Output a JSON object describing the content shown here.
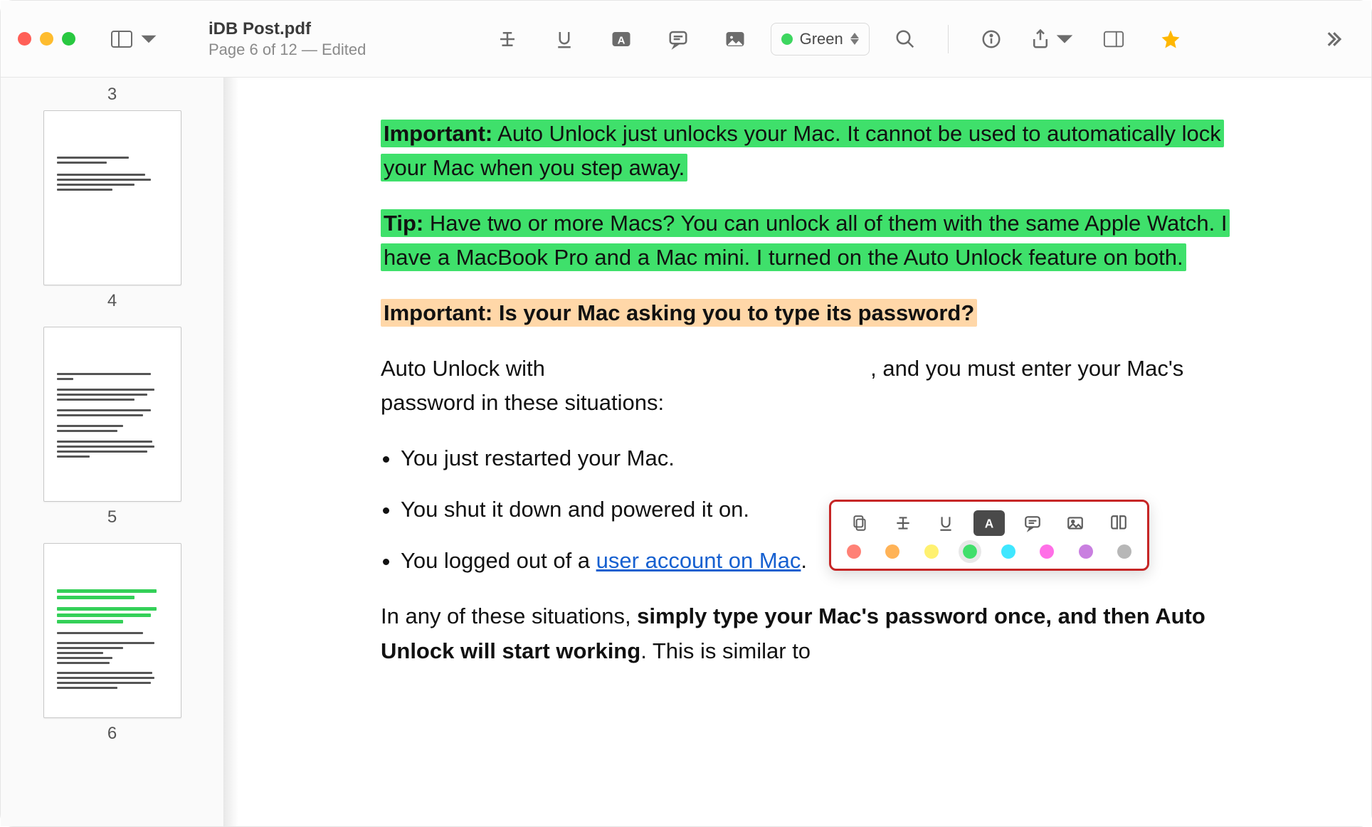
{
  "header": {
    "title": "iDB Post.pdf",
    "subtitle": "Page 6 of 12 — Edited",
    "color_label": "Green",
    "color_hex": "#3dd65f"
  },
  "sidebar": {
    "top_num": "3",
    "thumbs": [
      {
        "num": "4"
      },
      {
        "num": "5"
      },
      {
        "num": "6"
      }
    ]
  },
  "document": {
    "p1_bold": "Important:",
    "p1_rest": " Auto Unlock just unlocks your Mac. It cannot be used to automatically lock your Mac when you step away.",
    "p2_bold": "Tip:",
    "p2_rest": " Have two or more Macs? You can unlock all of them with the same Apple Watch. I have a MacBook Pro and a Mac mini. I turned on the Auto Unlock feature on both.",
    "h1": "Important: Is your Mac asking you to type its password?",
    "p3a": "Auto Unlock with",
    "p3b": ", and you must enter your Mac's password in these situations:",
    "li1": "You just restarted your Mac.",
    "li2": "You shut it down and powered it on.",
    "li3a": "You logged out of a ",
    "li3_link": "user account on Mac",
    "li3b": ".",
    "p4a": "In any of these situations, ",
    "p4_bold": "simply type your Mac's password once, and then Auto Unlock will start working",
    "p4b": ". This is similar to"
  },
  "popup": {
    "colors": [
      "red",
      "orange",
      "yellow",
      "green",
      "cyan",
      "magenta",
      "purple",
      "gray"
    ],
    "selected": "green"
  }
}
